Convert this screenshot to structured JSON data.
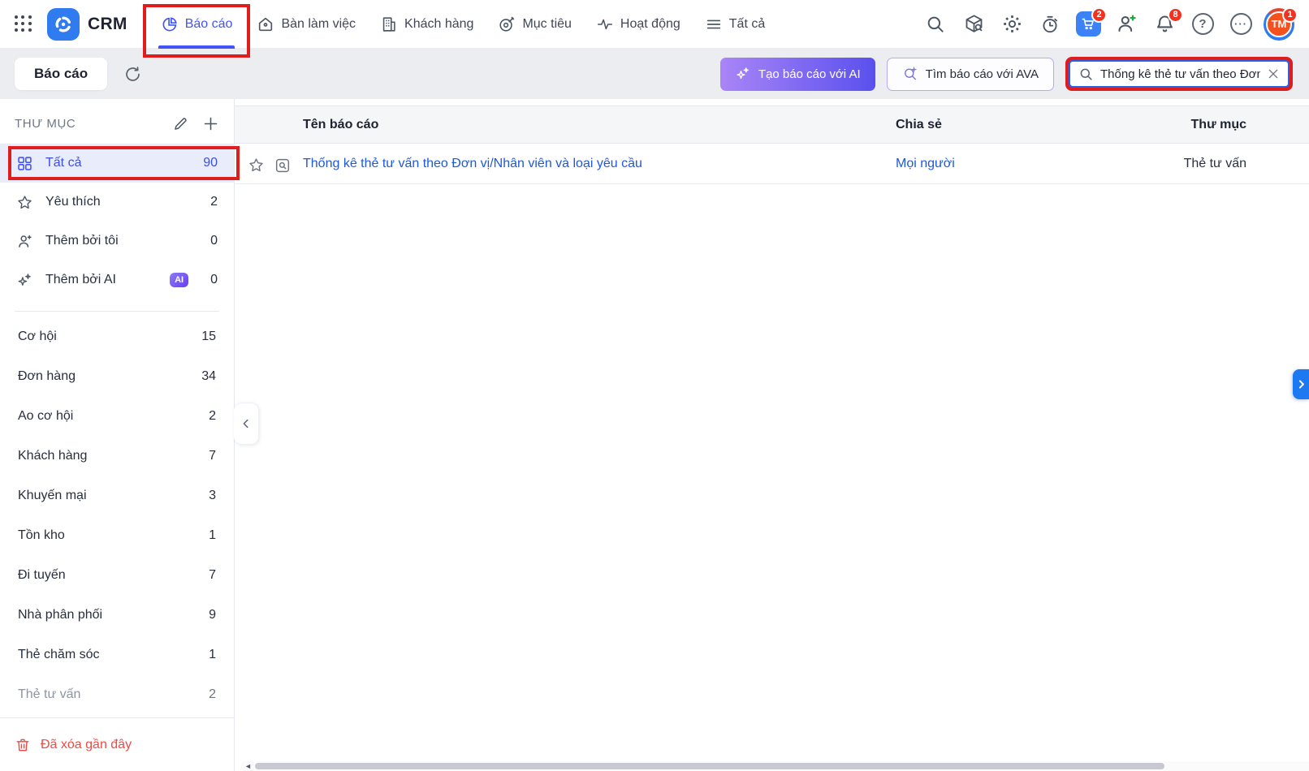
{
  "app": {
    "name": "CRM"
  },
  "nav": {
    "tabs": [
      {
        "label": "Báo cáo",
        "icon": "pie-chart-icon",
        "active": true
      },
      {
        "label": "Bàn làm việc",
        "icon": "home-icon",
        "active": false
      },
      {
        "label": "Khách hàng",
        "icon": "building-icon",
        "active": false
      },
      {
        "label": "Mục tiêu",
        "icon": "target-icon",
        "active": false
      },
      {
        "label": "Hoạt động",
        "icon": "activity-icon",
        "active": false
      },
      {
        "label": "Tất cả",
        "icon": "menu-icon",
        "active": false
      }
    ],
    "badges": {
      "cart": "2",
      "notifications": "8",
      "avatar": "1"
    },
    "avatar_initials": "TM",
    "icons": {
      "help": "?",
      "more": "···"
    }
  },
  "toolbar": {
    "title": "Báo cáo",
    "ai_create_label": "Tạo báo cáo với AI",
    "ava_find_label": "Tìm báo cáo với AVA",
    "search_value": "Thống kê thẻ tư vấn theo Đơn"
  },
  "sidebar": {
    "header": "THƯ MỤC",
    "items": [
      {
        "label": "Tất cả",
        "count": "90",
        "active": true
      },
      {
        "label": "Yêu thích",
        "count": "2"
      },
      {
        "label": "Thêm bởi tôi",
        "count": "0"
      },
      {
        "label": "Thêm bởi AI",
        "badge": "AI",
        "count": "0"
      }
    ],
    "folders": [
      {
        "label": "Cơ hội",
        "count": "15"
      },
      {
        "label": "Đơn hàng",
        "count": "34"
      },
      {
        "label": "Ao cơ hội",
        "count": "2"
      },
      {
        "label": "Khách hàng",
        "count": "7"
      },
      {
        "label": "Khuyến mại",
        "count": "3"
      },
      {
        "label": "Tồn kho",
        "count": "1"
      },
      {
        "label": "Đi tuyến",
        "count": "7"
      },
      {
        "label": "Nhà phân phối",
        "count": "9"
      },
      {
        "label": "Thẻ chăm sóc",
        "count": "1"
      },
      {
        "label": "Thẻ tư vấn",
        "count": "2"
      }
    ],
    "deleted_label": "Đã xóa gần đây"
  },
  "table": {
    "headers": {
      "name": "Tên báo cáo",
      "share": "Chia sẻ",
      "folder": "Thư mục"
    },
    "rows": [
      {
        "name": "Thống kê thẻ tư vấn theo Đơn vị/Nhân viên và loại yêu cầu",
        "share": "Mọi người",
        "folder": "Thẻ tư vấn"
      }
    ]
  },
  "colors": {
    "accent_blue": "#4254f5",
    "highlight_red": "#e01d1d",
    "link_blue": "#1f58d9",
    "gradient_start": "#a985f7",
    "gradient_end": "#5a50ee",
    "deleted_red": "#ee4b45",
    "cart_blue": "#3b82f6",
    "avatar_orange": "#f4511e",
    "badge_red": "#f2321f",
    "ai_badge_purple": "#6a3df0",
    "active_item_bg": "#e9ecfa"
  }
}
